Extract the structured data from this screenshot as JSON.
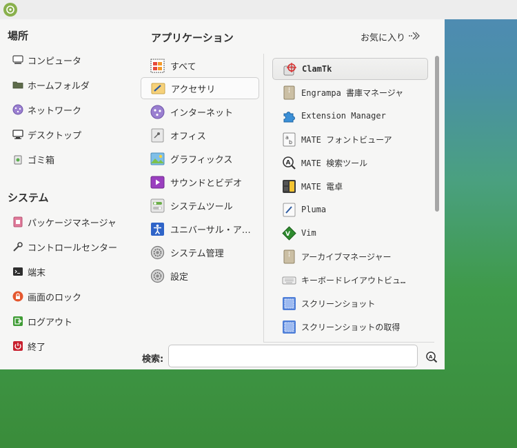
{
  "places": {
    "title": "場所",
    "items": [
      "コンピュータ",
      "ホームフォルダ",
      "ネットワーク",
      "デスクトップ",
      "ゴミ箱"
    ]
  },
  "system": {
    "title": "システム",
    "items": [
      "パッケージマネージャ",
      "コントロールセンター",
      "端末",
      "画面のロック",
      "ログアウト",
      "終了"
    ]
  },
  "applications": {
    "title": "アプリケーション",
    "favorites_label": "お気に入り",
    "categories": [
      "すべて",
      "アクセサリ",
      "インターネット",
      "オフィス",
      "グラフィックス",
      "サウンドとビデオ",
      "システムツール",
      "ユニバーサル・ア…",
      "システム管理",
      "設定"
    ],
    "selected_category": "アクセサリ",
    "apps": [
      "ClamTk",
      "Engrampa 書庫マネージャ",
      "Extension Manager",
      "MATE フォントビューア",
      "MATE 検索ツール",
      "MATE 電卓",
      "Pluma",
      "Vim",
      "アーカイブマネージャー",
      "キーボードレイアウトビュ…",
      "スクリーンショット",
      "スクリーンショットの取得"
    ],
    "selected_app": "ClamTk"
  },
  "search": {
    "label": "検索:",
    "value": ""
  },
  "colors": {
    "accent": "#89b04c",
    "panel_bg": "#f6f6f5"
  }
}
